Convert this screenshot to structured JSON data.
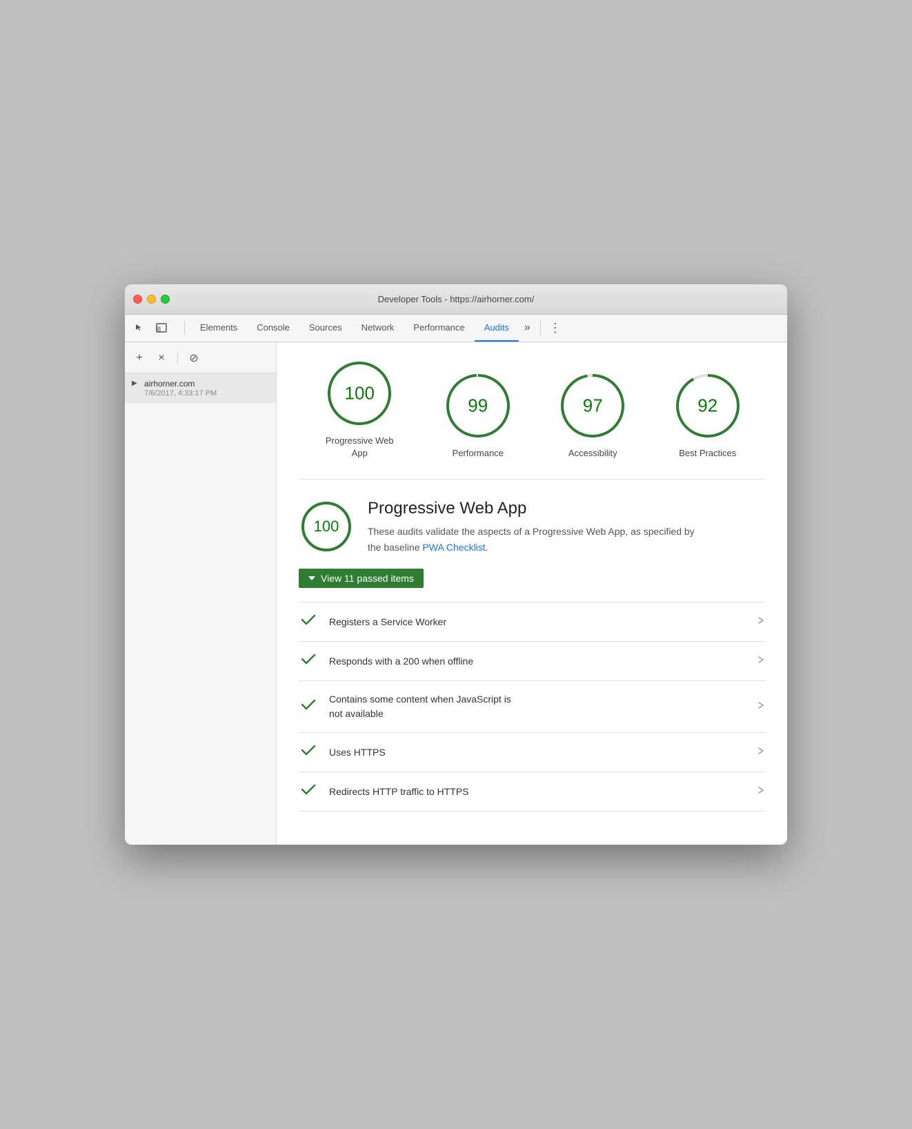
{
  "window": {
    "title": "Developer Tools - https://airhorner.com/"
  },
  "titlebar": {
    "title": "Developer Tools - https://airhorner.com/"
  },
  "tabs": {
    "items": [
      {
        "id": "elements",
        "label": "Elements",
        "active": false
      },
      {
        "id": "console",
        "label": "Console",
        "active": false
      },
      {
        "id": "sources",
        "label": "Sources",
        "active": false
      },
      {
        "id": "network",
        "label": "Network",
        "active": false
      },
      {
        "id": "performance",
        "label": "Performance",
        "active": false
      },
      {
        "id": "audits",
        "label": "Audits",
        "active": true
      }
    ],
    "more_label": "»",
    "kebab_label": "⋮"
  },
  "sidebar": {
    "add_label": "+",
    "close_label": "×",
    "block_label": "⊘",
    "item": {
      "title": "airhorner.com",
      "subtitle": "7/6/2017, 4:33:17 PM"
    }
  },
  "scores": [
    {
      "id": "pwa",
      "value": 100,
      "label": "Progressive Web App",
      "circumference": 283,
      "dash": 283
    },
    {
      "id": "performance",
      "value": 99,
      "label": "Performance",
      "circumference": 283,
      "dash": 280
    },
    {
      "id": "accessibility",
      "value": 97,
      "label": "Accessibility",
      "circumference": 283,
      "dash": 275
    },
    {
      "id": "best-practices",
      "value": 92,
      "label": "Best Practices",
      "circumference": 283,
      "dash": 261
    }
  ],
  "pwa_section": {
    "score": 100,
    "title": "Progressive Web App",
    "description_before": "These audits validate the aspects of a Progressive Web App, as specified by the baseline ",
    "link_label": "PWA Checklist",
    "description_after": ".",
    "view_passed_label": "View 11 passed items"
  },
  "audit_items": [
    {
      "id": "service-worker",
      "label": "Registers a Service Worker",
      "passed": true
    },
    {
      "id": "offline-200",
      "label": "Responds with a 200 when offline",
      "passed": true
    },
    {
      "id": "no-js-content",
      "label": "Contains some content when JavaScript is\nnot available",
      "passed": true
    },
    {
      "id": "https",
      "label": "Uses HTTPS",
      "passed": true
    },
    {
      "id": "http-redirect",
      "label": "Redirects HTTP traffic to HTTPS",
      "passed": true
    }
  ],
  "colors": {
    "green": "#2e7d32",
    "light_green": "#0a7a0a",
    "blue_link": "#1a73e8"
  }
}
